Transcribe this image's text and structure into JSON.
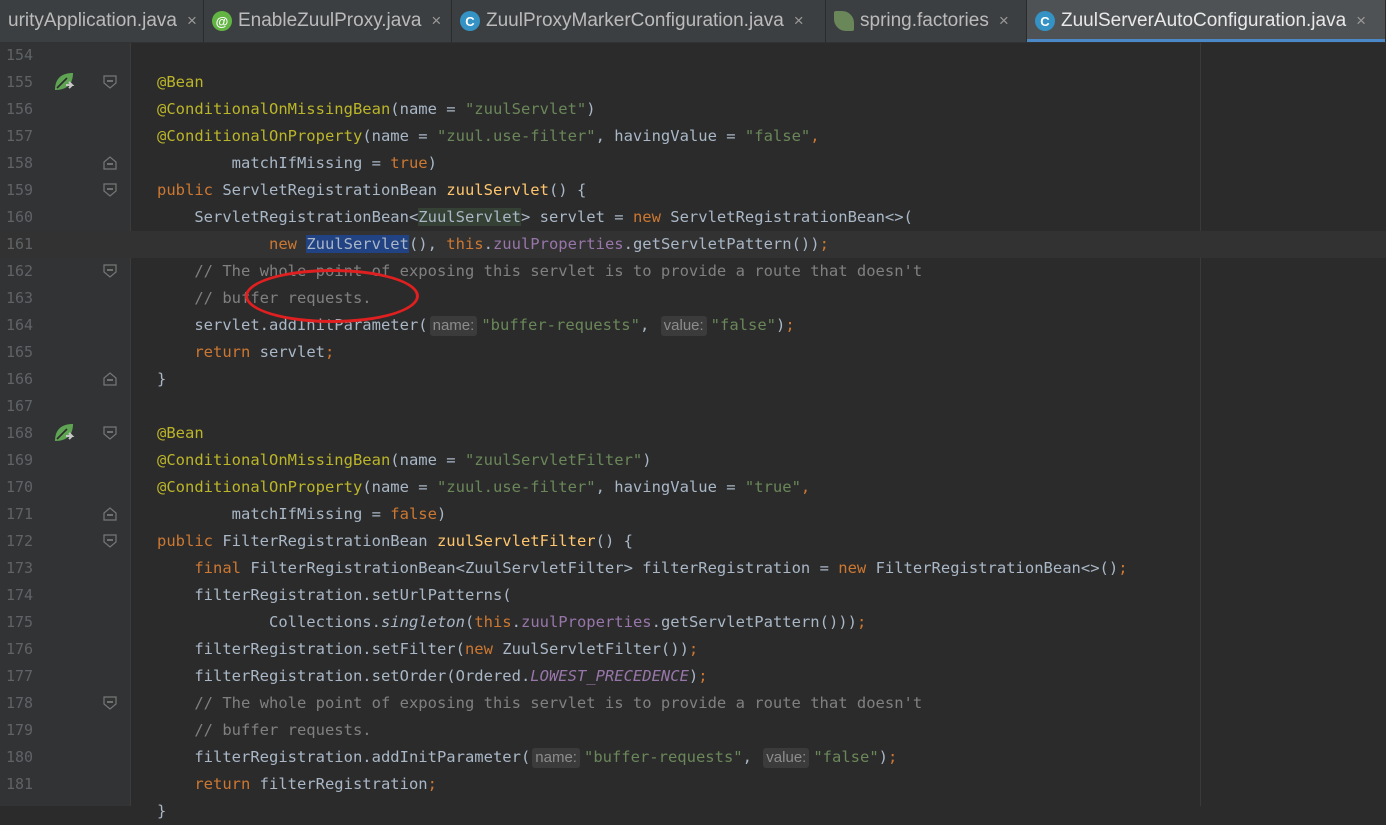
{
  "tabs": [
    {
      "label": "urityApplication.java",
      "icon": "",
      "active": false,
      "width": 204
    },
    {
      "label": "EnableZuulProxy.java",
      "icon": "annotation-icon",
      "active": false,
      "width": 248
    },
    {
      "label": "ZuulProxyMarkerConfiguration.java",
      "icon": "class-icon",
      "active": false,
      "width": 374
    },
    {
      "label": "spring.factories",
      "icon": "spring-leaf-icon",
      "active": false,
      "width": 201
    },
    {
      "label": "ZuulServerAutoConfiguration.java",
      "icon": "class-icon",
      "active": true,
      "width": 359
    }
  ],
  "tab_close_glyph": "×",
  "editor": {
    "highlighted_line": 161,
    "lines": [
      {
        "n": "154",
        "fold": "",
        "icon": false,
        "code": []
      },
      {
        "n": "155",
        "fold": "open",
        "icon": true,
        "code": [
          [
            "@Bean",
            "an"
          ]
        ]
      },
      {
        "n": "156",
        "fold": "",
        "icon": false,
        "code": [
          [
            "@ConditionalOnMissingBean",
            "an"
          ],
          [
            "(name = ",
            ""
          ],
          [
            "\"zuulServlet\"",
            "st"
          ],
          [
            ")",
            ""
          ]
        ]
      },
      {
        "n": "157",
        "fold": "",
        "icon": false,
        "code": [
          [
            "@ConditionalOnProperty",
            "an"
          ],
          [
            "(name = ",
            ""
          ],
          [
            "\"zuul.use-filter\"",
            "st"
          ],
          [
            ", havingValue = ",
            ""
          ],
          [
            "\"false\"",
            "st"
          ],
          [
            ",",
            "kw"
          ]
        ]
      },
      {
        "n": "158",
        "fold": "close",
        "icon": false,
        "code": [
          [
            "        matchIfMissing = ",
            ""
          ],
          [
            "true",
            "kw"
          ],
          [
            ")",
            ""
          ]
        ]
      },
      {
        "n": "159",
        "fold": "open",
        "icon": false,
        "code": [
          [
            "public ",
            "kw"
          ],
          [
            "ServletRegistrationBean ",
            ""
          ],
          [
            "zuulServlet",
            "fn"
          ],
          [
            "() {",
            ""
          ]
        ]
      },
      {
        "n": "160",
        "fold": "",
        "icon": false,
        "code": [
          [
            "    ServletRegistrationBean<",
            ""
          ],
          [
            "ZuulServlet",
            "typehl"
          ],
          [
            "> servlet = ",
            ""
          ],
          [
            "new ",
            "kw"
          ],
          [
            "ServletRegistrationBean<>(",
            ""
          ]
        ]
      },
      {
        "n": "161",
        "fold": "",
        "icon": false,
        "code": [
          [
            "            ",
            ""
          ],
          [
            "new ",
            "kw"
          ],
          [
            "ZuulServlet",
            "hl"
          ],
          [
            "(), ",
            ""
          ],
          [
            "this",
            "kw"
          ],
          [
            ".",
            ""
          ],
          [
            "zuulProperties",
            "fd"
          ],
          [
            ".getServletPattern())",
            ""
          ],
          [
            ";",
            "kw"
          ]
        ]
      },
      {
        "n": "162",
        "fold": "open",
        "icon": false,
        "code": [
          [
            "    // The whole point of exposing this servlet is to provide a route that doesn't",
            "cm"
          ]
        ]
      },
      {
        "n": "163",
        "fold": "",
        "icon": false,
        "code": [
          [
            "    // buffer requests.",
            "cm"
          ]
        ]
      },
      {
        "n": "164",
        "fold": "",
        "icon": false,
        "code": [
          [
            "    servlet.addInitParameter(",
            ""
          ],
          [
            "name:",
            "hint"
          ],
          [
            "\"buffer-requests\"",
            "st"
          ],
          [
            ", ",
            ""
          ],
          [
            "value:",
            "hint"
          ],
          [
            "\"false\"",
            "st"
          ],
          [
            ")",
            ""
          ],
          [
            ";",
            "kw"
          ]
        ]
      },
      {
        "n": "165",
        "fold": "",
        "icon": false,
        "code": [
          [
            "    ",
            ""
          ],
          [
            "return ",
            "kw"
          ],
          [
            "servlet",
            ""
          ],
          [
            ";",
            "kw"
          ]
        ]
      },
      {
        "n": "166",
        "fold": "close",
        "icon": false,
        "code": [
          [
            "}",
            ""
          ]
        ]
      },
      {
        "n": "167",
        "fold": "",
        "icon": false,
        "code": []
      },
      {
        "n": "168",
        "fold": "open",
        "icon": true,
        "code": [
          [
            "@Bean",
            "an"
          ]
        ]
      },
      {
        "n": "169",
        "fold": "",
        "icon": false,
        "code": [
          [
            "@ConditionalOnMissingBean",
            "an"
          ],
          [
            "(name = ",
            ""
          ],
          [
            "\"zuulServletFilter\"",
            "st"
          ],
          [
            ")",
            ""
          ]
        ]
      },
      {
        "n": "170",
        "fold": "",
        "icon": false,
        "code": [
          [
            "@ConditionalOnProperty",
            "an"
          ],
          [
            "(name = ",
            ""
          ],
          [
            "\"zuul.use-filter\"",
            "st"
          ],
          [
            ", havingValue = ",
            ""
          ],
          [
            "\"true\"",
            "st"
          ],
          [
            ",",
            "kw"
          ]
        ]
      },
      {
        "n": "171",
        "fold": "close",
        "icon": false,
        "code": [
          [
            "        matchIfMissing = ",
            ""
          ],
          [
            "false",
            "kw"
          ],
          [
            ")",
            ""
          ]
        ]
      },
      {
        "n": "172",
        "fold": "open",
        "icon": false,
        "code": [
          [
            "public ",
            "kw"
          ],
          [
            "FilterRegistrationBean ",
            ""
          ],
          [
            "zuulServletFilter",
            "fn"
          ],
          [
            "() {",
            ""
          ]
        ]
      },
      {
        "n": "173",
        "fold": "",
        "icon": false,
        "code": [
          [
            "    ",
            ""
          ],
          [
            "final ",
            "kw"
          ],
          [
            "FilterRegistrationBean<ZuulServletFilter> filterRegistration = ",
            ""
          ],
          [
            "new ",
            "kw"
          ],
          [
            "FilterRegistrationBean<>()",
            ""
          ],
          [
            ";",
            "kw"
          ]
        ]
      },
      {
        "n": "174",
        "fold": "",
        "icon": false,
        "code": [
          [
            "    filterRegistration.setUrlPatterns(",
            ""
          ]
        ]
      },
      {
        "n": "175",
        "fold": "",
        "icon": false,
        "code": [
          [
            "            Collections.",
            ""
          ],
          [
            "singleton",
            "it"
          ],
          [
            "(",
            ""
          ],
          [
            "this",
            "kw"
          ],
          [
            ".",
            ""
          ],
          [
            "zuulProperties",
            "fd"
          ],
          [
            ".getServletPattern()))",
            ""
          ],
          [
            ";",
            "kw"
          ]
        ]
      },
      {
        "n": "176",
        "fold": "",
        "icon": false,
        "code": [
          [
            "    filterRegistration.setFilter(",
            ""
          ],
          [
            "new ",
            "kw"
          ],
          [
            "ZuulServletFilter())",
            ""
          ],
          [
            ";",
            "kw"
          ]
        ]
      },
      {
        "n": "177",
        "fold": "",
        "icon": false,
        "code": [
          [
            "    filterRegistration.setOrder(Ordered.",
            ""
          ],
          [
            "LOWEST_PRECEDENCE",
            "ist"
          ],
          [
            ")",
            ""
          ],
          [
            ";",
            "kw"
          ]
        ]
      },
      {
        "n": "178",
        "fold": "open",
        "icon": false,
        "code": [
          [
            "    // The whole point of exposing this servlet is to provide a route that doesn't",
            "cm"
          ]
        ]
      },
      {
        "n": "179",
        "fold": "",
        "icon": false,
        "code": [
          [
            "    // buffer requests.",
            "cm"
          ]
        ]
      },
      {
        "n": "180",
        "fold": "",
        "icon": false,
        "code": [
          [
            "    filterRegistration.addInitParameter(",
            ""
          ],
          [
            "name:",
            "hint"
          ],
          [
            "\"buffer-requests\"",
            "st"
          ],
          [
            ", ",
            ""
          ],
          [
            "value:",
            "hint"
          ],
          [
            "\"false\"",
            "st"
          ],
          [
            ")",
            ""
          ],
          [
            ";",
            "kw"
          ]
        ]
      },
      {
        "n": "181",
        "fold": "",
        "icon": false,
        "code": [
          [
            "    ",
            ""
          ],
          [
            "return ",
            "kw"
          ],
          [
            "filterRegistration",
            ""
          ],
          [
            ";",
            "kw"
          ]
        ]
      },
      {
        "n": "",
        "fold": "",
        "icon": false,
        "code": [
          [
            "}",
            ""
          ]
        ]
      }
    ]
  },
  "colors": {
    "annotation_circle": "#e02020",
    "selection": "#214283"
  }
}
